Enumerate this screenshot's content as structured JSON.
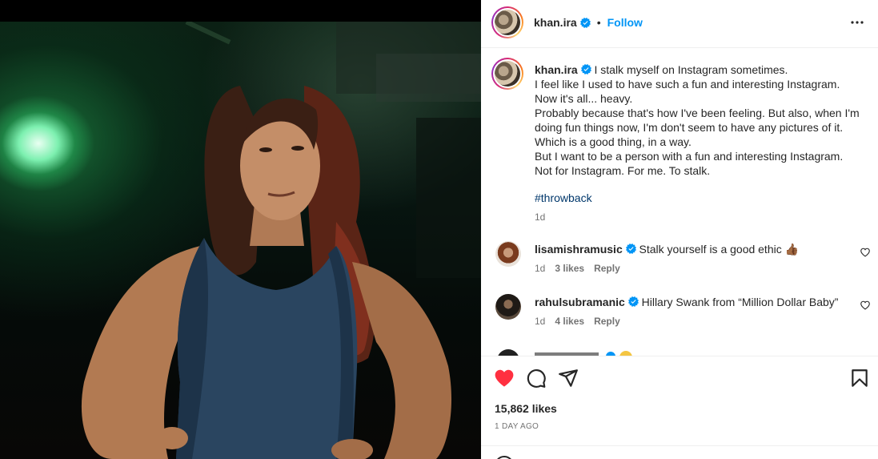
{
  "post": {
    "username": "khan.ira",
    "verified": true,
    "follow_label": "Follow",
    "dot": "•",
    "caption": "I stalk myself on Instagram sometimes.\nI feel like I used to have such a fun and interesting Instagram.\nNow it's all... heavy.\nProbably because that's how I've been feeling. But also, when I'm doing fun things now, I'm don't seem to have any pictures of it.\nWhich is a good thing, in a way.\nBut I want to be a person with a fun and interesting Instagram.\nNot for Instagram. For me. To stalk.",
    "hashtag": "#throwback",
    "caption_time": "1d",
    "likes": "15,862 likes",
    "date": "1 DAY AGO"
  },
  "comments": [
    {
      "username": "lisamishramusic",
      "verified": true,
      "text": "Stalk yourself is a good ethic 👍🏾",
      "time": "1d",
      "likes": "3 likes",
      "reply": "Reply"
    },
    {
      "username": "rahulsubramanic",
      "verified": true,
      "text": "Hillary Swank from “Million Dollar Baby”",
      "time": "1d",
      "likes": "4 likes",
      "reply": "Reply"
    }
  ],
  "colors": {
    "accent": "#0095f6",
    "like_red": "#ff3040",
    "hashtag": "#00376b",
    "muted": "#737373"
  },
  "icons": [
    "more-icon",
    "heart-filled-icon",
    "comment-icon",
    "share-icon",
    "save-icon",
    "verified-icon",
    "small-heart-icon"
  ]
}
